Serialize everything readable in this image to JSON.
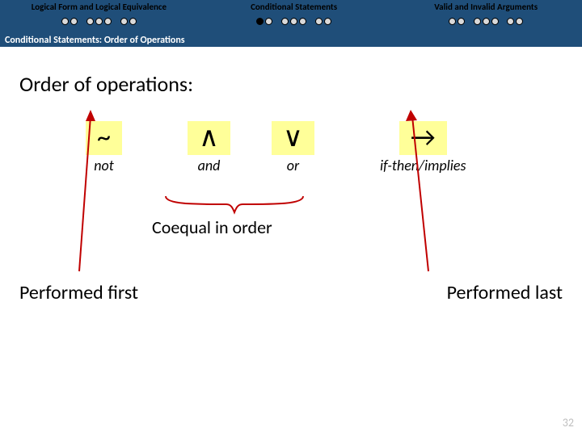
{
  "header": {
    "sections": [
      {
        "title": "Logical Form and Logical Equivalence"
      },
      {
        "title": "Conditional Statements"
      },
      {
        "title": "Valid and Invalid Arguments"
      }
    ],
    "subtitle": "Conditional Statements: Order of Operations"
  },
  "main": {
    "title": "Order of operations:",
    "operators": {
      "not": {
        "symbol": "~",
        "label": "not"
      },
      "and": {
        "symbol": "∧",
        "label": "and"
      },
      "or": {
        "symbol": "∨",
        "label": "or"
      },
      "implies": {
        "symbol": "→",
        "label": "if-then/implies"
      }
    },
    "coequal_label": "Coequal in order",
    "performed_first": "Performed first",
    "performed_last": "Performed last"
  },
  "page_number": "32"
}
